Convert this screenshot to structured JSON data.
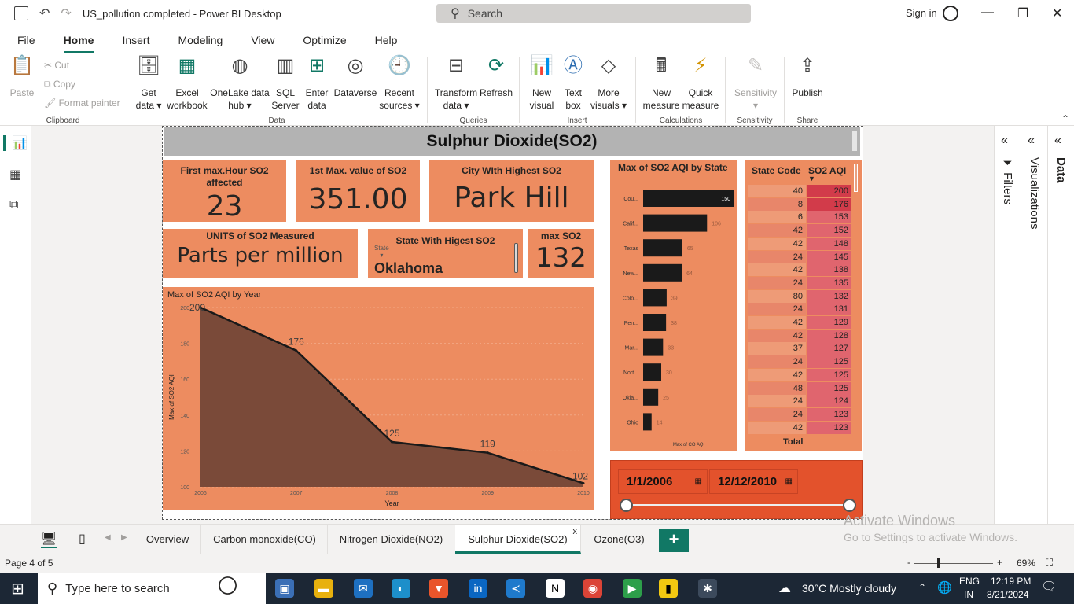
{
  "window": {
    "title": "US_pollution completed - Power BI Desktop",
    "search_placeholder": "Search",
    "signin": "Sign in"
  },
  "menu": [
    "File",
    "Home",
    "Insert",
    "Modeling",
    "View",
    "Optimize",
    "Help"
  ],
  "ribbon": {
    "clipboard": {
      "paste": "Paste",
      "cut": "Cut",
      "copy": "Copy",
      "format_painter": "Format painter",
      "group": "Clipboard"
    },
    "data": {
      "get_data": "Get data",
      "excel": "Excel workbook",
      "onelake": "OneLake data hub",
      "sql": "SQL Server",
      "enter": "Enter data",
      "dataverse": "Dataverse",
      "recent": "Recent sources",
      "group": "Data"
    },
    "queries": {
      "transform": "Transform data",
      "refresh": "Refresh",
      "group": "Queries"
    },
    "insert": {
      "new_visual": "New visual",
      "text_box": "Text box",
      "more_visuals": "More visuals",
      "group": "Insert"
    },
    "calculations": {
      "new_measure": "New measure",
      "quick_measure": "Quick measure",
      "group": "Calculations"
    },
    "sensitivity": {
      "label": "Sensitivity",
      "group": "Sensitivity"
    },
    "share": {
      "publish": "Publish",
      "group": "Share"
    }
  },
  "report": {
    "title": "Sulphur Dioxide(SO2)",
    "cards": {
      "first_max_hour": {
        "label": "First max.Hour SO2 affected",
        "value": "23"
      },
      "first_max_value": {
        "label": "1st Max. value of SO2",
        "value": "351.00"
      },
      "city_highest": {
        "label": "City WIth Highest SO2",
        "value": "Park Hill"
      },
      "units": {
        "label": "UNITS of SO2 Measured",
        "value": "Parts per million"
      },
      "state_highest": {
        "label": "State With Higest SO2",
        "field": "State",
        "value": "Oklahoma"
      },
      "max_so2": {
        "label": "max SO2",
        "value": "132"
      }
    },
    "date_slicer": {
      "start": "1/1/2006",
      "end": "12/12/2010"
    }
  },
  "chart_data": [
    {
      "type": "area",
      "title": "Max of SO2 AQI by Year",
      "xlabel": "Year",
      "ylabel": "Max of SO2 AQI",
      "x": [
        2006,
        2007,
        2008,
        2009,
        2010
      ],
      "values": [
        200,
        176,
        125,
        119,
        102
      ],
      "ylim": [
        100,
        200
      ],
      "yticks": [
        100,
        120,
        140,
        160,
        180,
        200
      ],
      "data_labels": [
        "200",
        "176",
        "125",
        "119",
        "102"
      ],
      "colors": {
        "fill": "#7a4a39",
        "line": "#1a1a1a",
        "background": "#ed8c60"
      }
    },
    {
      "type": "bar",
      "orientation": "horizontal",
      "title": "Max of SO2 AQI by State",
      "xlabel": "Max of CO AQI",
      "categories": [
        "Cou...",
        "Calif...",
        "Texas",
        "New...",
        "Colo...",
        "Pen...",
        "Mar...",
        "Nort...",
        "Okla...",
        "Ohio"
      ],
      "values": [
        150,
        106,
        65,
        64,
        39,
        38,
        33,
        30,
        25,
        14
      ],
      "colors": {
        "bar": "#1a1a1a",
        "background": "#ed8c60"
      }
    },
    {
      "type": "table",
      "columns": [
        "State Code",
        "SO2 AQI"
      ],
      "rows": [
        [
          40,
          200
        ],
        [
          8,
          176
        ],
        [
          6,
          153
        ],
        [
          42,
          152
        ],
        [
          42,
          148
        ],
        [
          24,
          145
        ],
        [
          42,
          138
        ],
        [
          24,
          135
        ],
        [
          80,
          132
        ],
        [
          24,
          131
        ],
        [
          42,
          129
        ],
        [
          42,
          128
        ],
        [
          37,
          127
        ],
        [
          24,
          125
        ],
        [
          42,
          125
        ],
        [
          48,
          125
        ],
        [
          24,
          124
        ],
        [
          24,
          123
        ],
        [
          42,
          123
        ]
      ],
      "total_label": "Total",
      "colors": {
        "high": "#d23b4a",
        "low": "#e0656e"
      }
    }
  ],
  "right_panes": [
    "Filters",
    "Visualizations",
    "Data"
  ],
  "watermark": {
    "line1": "Activate Windows",
    "line2": "Go to Settings to activate Windows."
  },
  "pages": [
    "Overview",
    "Carbon monoxide(CO)",
    "Nitrogen Dioxide(NO2)",
    "Sulphur Dioxide(SO2)",
    "Ozone(O3)"
  ],
  "status": {
    "page": "Page 4 of 5",
    "zoom": "69%"
  },
  "taskbar": {
    "search": "Type here to search",
    "weather": "30°C  Mostly cloudy",
    "lang": "ENG",
    "region": "IN",
    "time": "12:19 PM",
    "date": "8/21/2024"
  }
}
